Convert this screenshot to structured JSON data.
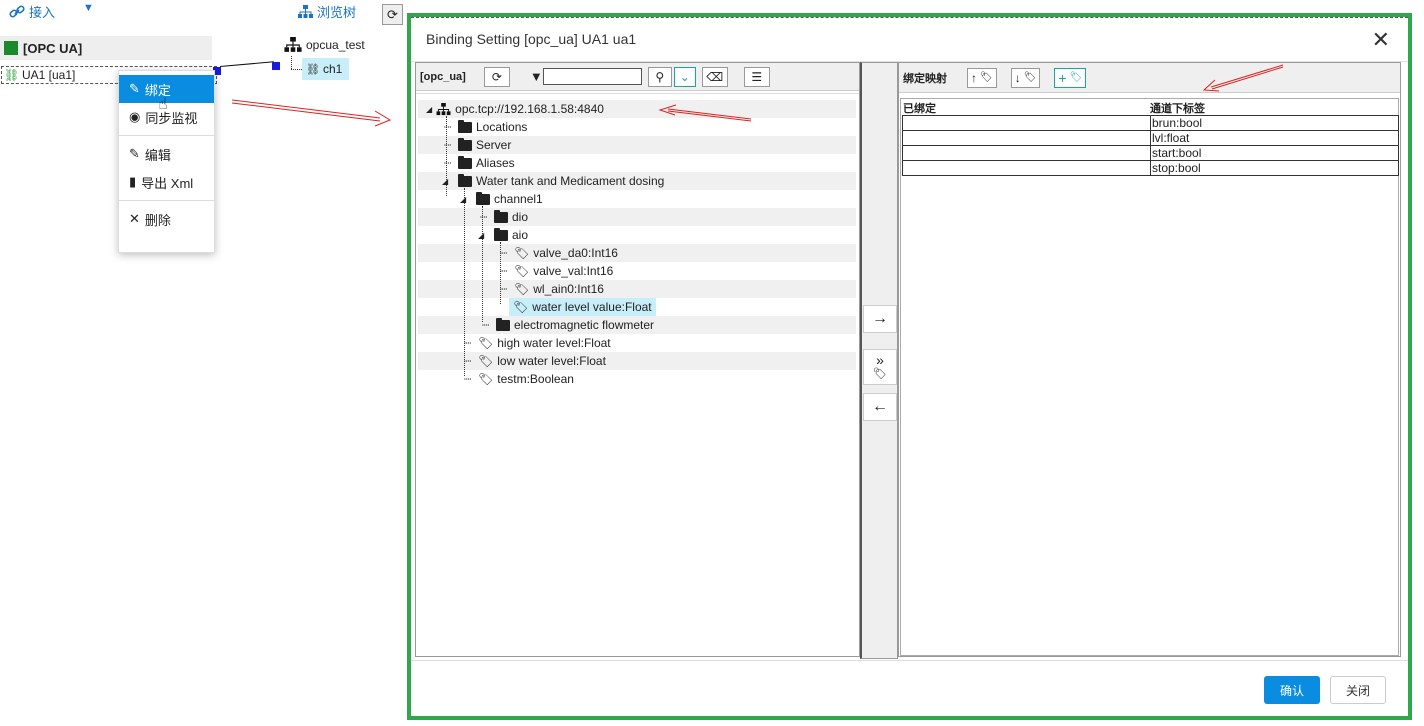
{
  "bg": {
    "connect_label": "接入",
    "browse_tree_label": "浏览树",
    "opc_ua_header": "[OPC UA]",
    "ua1_label": "UA1 [ua1]",
    "right_tree_root": "opcua_test",
    "right_tree_child": "ch1",
    "context_menu": {
      "bind": "绑定",
      "sync_monitor": "同步监视",
      "edit": "编辑",
      "export_xml": "导出 Xml",
      "delete": "删除"
    }
  },
  "modal": {
    "title": "Binding Setting [opc_ua] UA1 ua1",
    "left_label": "[opc_ua]",
    "filter_value": "",
    "tree": [
      {
        "label": "opc.tcp://192.168.1.58:4840",
        "kind": "root"
      },
      {
        "label": "Locations",
        "kind": "folder"
      },
      {
        "label": "Server",
        "kind": "folder"
      },
      {
        "label": "Aliases",
        "kind": "folder"
      },
      {
        "label": "Water tank and Medicament dosing",
        "kind": "folder"
      },
      {
        "label": "channel1",
        "kind": "folder"
      },
      {
        "label": "dio",
        "kind": "folder"
      },
      {
        "label": "aio",
        "kind": "folder"
      },
      {
        "label": "valve_da0:Int16",
        "kind": "tag"
      },
      {
        "label": "valve_val:Int16",
        "kind": "tag"
      },
      {
        "label": "wl_ain0:Int16",
        "kind": "tag"
      },
      {
        "label": "water level value:Float",
        "kind": "tag"
      },
      {
        "label": "electromagnetic flowmeter",
        "kind": "folder"
      },
      {
        "label": "high water level:Float",
        "kind": "tag"
      },
      {
        "label": "low water level:Float",
        "kind": "tag"
      },
      {
        "label": "testm:Boolean",
        "kind": "tag"
      }
    ],
    "mapping_label": "绑定映射",
    "col_bound": "已绑定",
    "col_channel_tag": "通道下标签",
    "rows": [
      {
        "bound": "",
        "tag": "brun:bool"
      },
      {
        "bound": "",
        "tag": "lvl:float"
      },
      {
        "bound": "",
        "tag": "start:bool"
      },
      {
        "bound": "",
        "tag": "stop:bool"
      }
    ],
    "confirm_label": "确认",
    "close_label": "关闭"
  },
  "colors": {
    "accent": "#0a8de0",
    "frame": "#2ea84a",
    "selected": "#c8eefa",
    "teal": "#1aa5a0"
  }
}
